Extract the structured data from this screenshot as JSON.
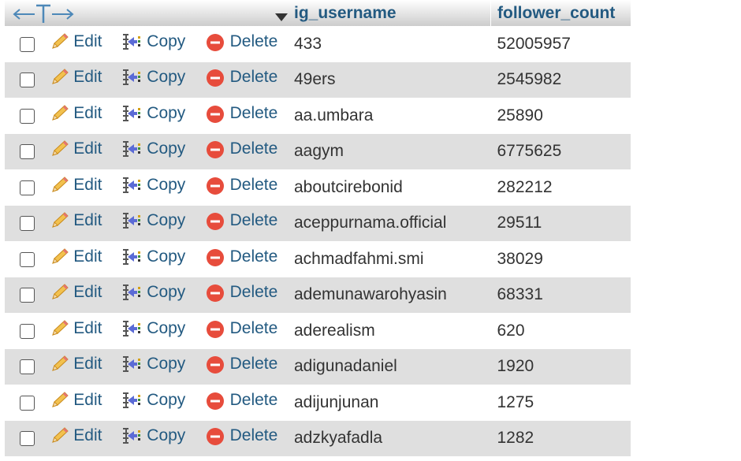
{
  "header": {
    "col_username": "ig_username",
    "col_count": "follower_count"
  },
  "actions": {
    "edit_label": "Edit",
    "copy_label": "Copy",
    "delete_label": "Delete"
  },
  "icons": {
    "arrows": "left-right-arrows-icon",
    "sort": "sort-caret-icon",
    "edit": "pencil-icon",
    "copy": "copy-insert-icon",
    "delete": "delete-circle-icon"
  },
  "colors": {
    "link": "#235a81",
    "row_alt": "#dfdfdf",
    "delete_red": "#e74c3c"
  },
  "rows": [
    {
      "ig_username": "433",
      "follower_count": "52005957"
    },
    {
      "ig_username": "49ers",
      "follower_count": "2545982"
    },
    {
      "ig_username": "aa.umbara",
      "follower_count": "25890"
    },
    {
      "ig_username": "aagym",
      "follower_count": "6775625"
    },
    {
      "ig_username": "aboutcirebonid",
      "follower_count": "282212"
    },
    {
      "ig_username": "aceppurnama.official",
      "follower_count": "29511"
    },
    {
      "ig_username": "achmadfahmi.smi",
      "follower_count": "38029"
    },
    {
      "ig_username": "ademunawarohyasin",
      "follower_count": "68331"
    },
    {
      "ig_username": "aderealism",
      "follower_count": "620"
    },
    {
      "ig_username": "adigunadaniel",
      "follower_count": "1920"
    },
    {
      "ig_username": "adijunjunan",
      "follower_count": "1275"
    },
    {
      "ig_username": "adzkyafadla",
      "follower_count": "1282"
    }
  ]
}
